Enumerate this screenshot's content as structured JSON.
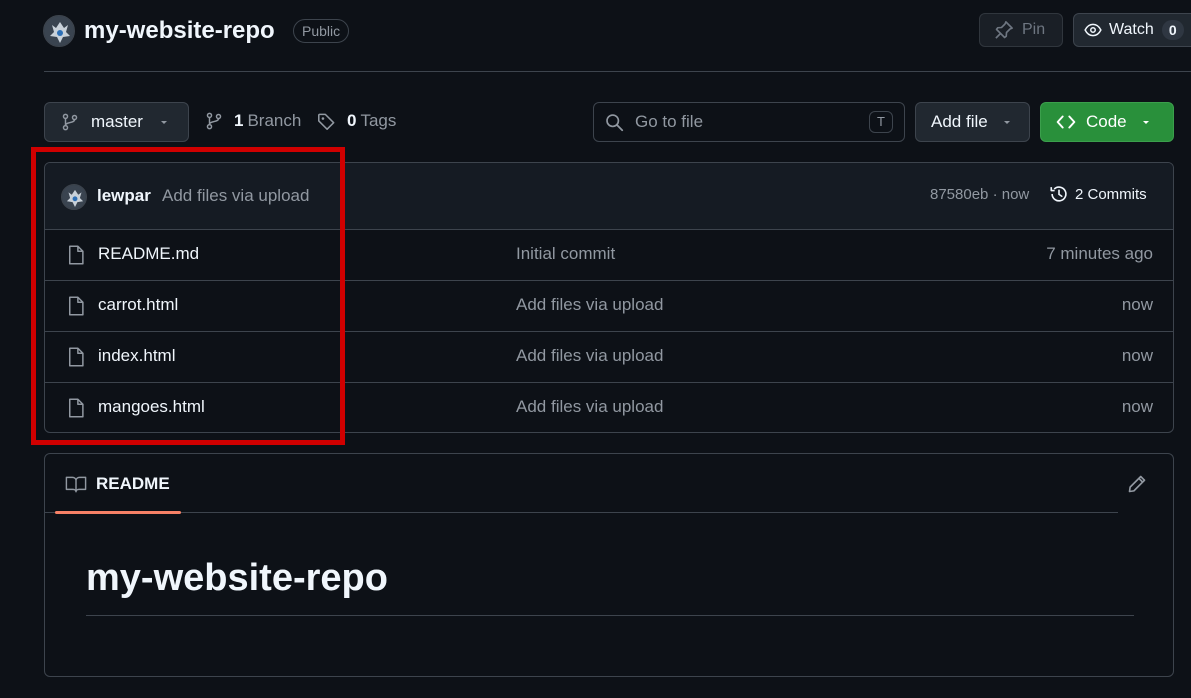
{
  "repo": {
    "name": "my-website-repo",
    "visibility": "Public"
  },
  "header_actions": {
    "pin_label": "Pin",
    "watch_label": "Watch",
    "watch_count": "0"
  },
  "toolbar": {
    "branch": "master",
    "branch_count": "1",
    "branch_word": "Branch",
    "tag_count": "0",
    "tag_word": "Tags",
    "go_to_file_placeholder": "Go to file",
    "go_to_file_shortcut": "T",
    "add_file_label": "Add file",
    "code_label": "Code"
  },
  "latest_commit": {
    "author": "lewpar",
    "message": "Add files via upload",
    "meta": "87580eb · now",
    "commits_label": "2 Commits"
  },
  "files": [
    {
      "name": "README.md",
      "message": "Initial commit",
      "time": "7 minutes ago"
    },
    {
      "name": "carrot.html",
      "message": "Add files via upload",
      "time": "now"
    },
    {
      "name": "index.html",
      "message": "Add files via upload",
      "time": "now"
    },
    {
      "name": "mangoes.html",
      "message": "Add files via upload",
      "time": "now"
    }
  ],
  "readme": {
    "tab_label": "README",
    "heading": "my-website-repo"
  },
  "colors": {
    "background": "#0d1117",
    "border": "#3d444d",
    "code_button": "#29903b",
    "highlight": "#d00000",
    "tab_underline": "#f78166"
  },
  "icons": [
    "avatar",
    "pin-icon",
    "eye-icon",
    "git-branch-icon",
    "tag-icon",
    "search-icon",
    "chevron-down-icon",
    "code-icon",
    "history-icon",
    "file-icon",
    "book-icon",
    "pencil-icon"
  ]
}
